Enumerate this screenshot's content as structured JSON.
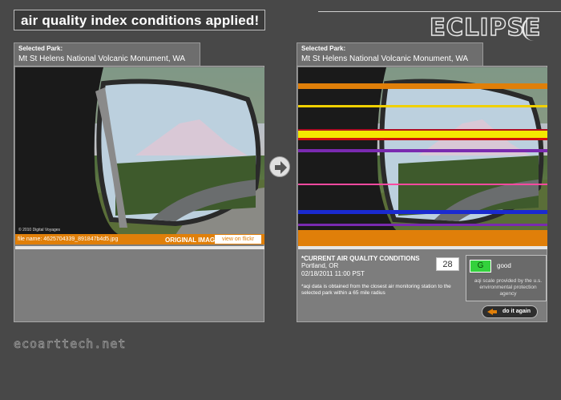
{
  "header": {
    "banner_text": "air quality index conditions applied!",
    "logo_text": "ECLIPSE",
    "logo_icon": "crescent-moon-icon"
  },
  "left_panel": {
    "park_label": "Selected Park:",
    "park_name": "Mt St Helens National Volcanic Monument, WA",
    "file_name": "file name: 4625704339_891847b4d5.jpg",
    "image_label": "ORIGINAL IMAGE",
    "view_button": "view on flickr",
    "copyright": "© 2010 Digital Voyages"
  },
  "right_panel": {
    "park_label": "Selected Park:",
    "park_name": "Mt St Helens National Volcanic Monument, WA",
    "conditions_title": "*CURRENT AIR QUALITY CONDITIONS",
    "location": "Portland, OR",
    "datetime": "02/18/2011 11:00 PST",
    "aqi_value": "28",
    "aqi_grade": "G",
    "aqi_description": "good",
    "aqi_credit": "aqi scale provided by the u.s. environmental protection agency",
    "note": "*aqi data is obtained from the closest air monitoring station to the selected park within a 65 mile radius",
    "again_button": "do it again",
    "stripe_colors": [
      "#e07f09",
      "#f0d000",
      "#b01020",
      "#f4e800",
      "#d01010",
      "#7a2ab0",
      "#ff4aa0",
      "#1a2ad0",
      "#7a2ab0",
      "#e07f09"
    ]
  },
  "footer": {
    "site": "ecoarttech.net"
  },
  "colors": {
    "accent": "#e07f09",
    "background": "#484848",
    "panel": "#7d7d7d",
    "aqi_good": "#33d13c"
  },
  "icons": {
    "arrow": "arrow-right-icon",
    "again": "arrow-left-icon"
  }
}
